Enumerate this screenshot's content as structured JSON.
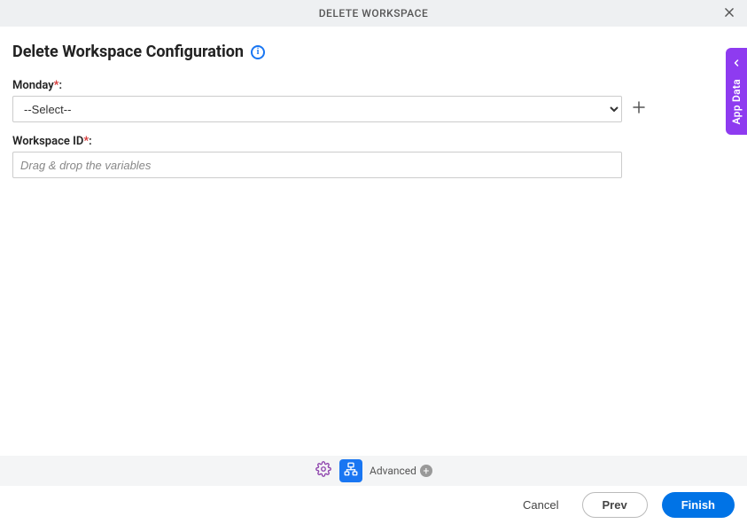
{
  "header": {
    "title": "DELETE WORKSPACE"
  },
  "page": {
    "title": "Delete Workspace Configuration"
  },
  "fields": {
    "monday": {
      "label": "Monday",
      "required_marker": "*",
      "colon": ":",
      "selected": "--Select--"
    },
    "workspace_id": {
      "label": "Workspace ID",
      "required_marker": "*",
      "colon": ":",
      "placeholder": "Drag & drop the variables"
    }
  },
  "advanced": {
    "label": "Advanced"
  },
  "footer": {
    "cancel": "Cancel",
    "prev": "Prev",
    "finish": "Finish"
  },
  "side_tab": {
    "label": "App Data"
  }
}
